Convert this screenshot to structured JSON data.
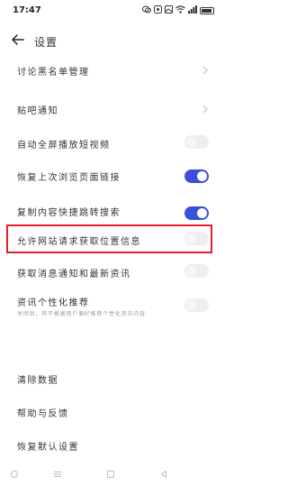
{
  "status_bar": {
    "time": "17:47",
    "icons": [
      "wechat-icon",
      "notification-icon",
      "image-icon",
      "wifi-icon",
      "signal-icon",
      "battery-icon"
    ]
  },
  "header": {
    "title": "设置"
  },
  "rows": [
    {
      "title": "讨论黑名单管理",
      "subtitle": "",
      "control": "chevron"
    },
    {
      "title": "贴吧通知",
      "subtitle": "",
      "control": "chevron"
    },
    {
      "title": "自动全屏播放短视频",
      "subtitle": "",
      "control": "toggle",
      "checked": false
    },
    {
      "title": "恢复上次浏览页面链接",
      "subtitle": "",
      "control": "toggle",
      "checked": true
    },
    {
      "title": "复制内容快捷跳转搜索",
      "subtitle": "",
      "control": "toggle",
      "checked": true
    },
    {
      "title": "允许网站请求获取位置信息",
      "subtitle": "",
      "control": "toggle",
      "checked": false
    },
    {
      "title": "获取消息通知和最新资讯",
      "subtitle": "",
      "control": "toggle",
      "checked": false
    },
    {
      "title": "资讯个性化推荐",
      "subtitle": "关闭后，将不根据用户偏好推荐个性化资讯内容",
      "control": "toggle",
      "checked": false
    },
    {
      "title": "清除数据",
      "subtitle": "",
      "control": "none"
    },
    {
      "title": "帮助与反馈",
      "subtitle": "",
      "control": "none"
    },
    {
      "title": "恢复默认设置",
      "subtitle": "",
      "control": "none"
    }
  ],
  "colors": {
    "toggle_on": "#3b4fd8",
    "toggle_off": "#eeeeee",
    "highlight_border": "#e0212b"
  },
  "nav_bar": [
    "home-icon",
    "menu-icon",
    "tabs-icon",
    "back-triangle-icon"
  ]
}
